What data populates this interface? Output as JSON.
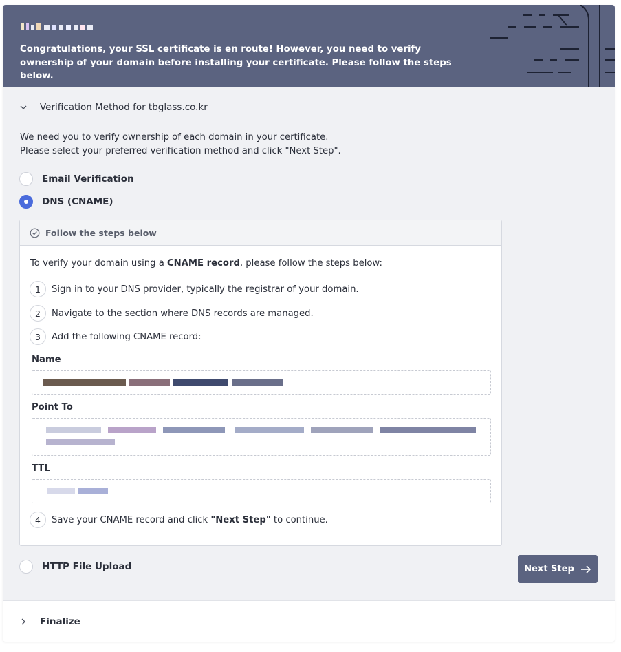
{
  "banner": {
    "title_redacted": "",
    "message": "Congratulations, your SSL certificate is en route! However, you need to verify ownership of your domain before installing your certificate. Please follow the steps below.",
    "background_color": "#5b6380"
  },
  "verification": {
    "section_title": "Verification Method for tbglass.co.kr",
    "expanded": true,
    "intro_line1": "We need you to verify ownership of each domain in your certificate.",
    "intro_line2": "Please select your preferred verification method and click \"Next Step\".",
    "methods": [
      {
        "label": "Email Verification",
        "selected": false
      },
      {
        "label": "DNS (CNAME)",
        "selected": true
      },
      {
        "label": "HTTP File Upload",
        "selected": false
      }
    ],
    "accent_color": "#4a6bdc"
  },
  "steps": {
    "header": "Follow the steps below",
    "header_icon": "check-circle-icon",
    "lead_before": "To verify your domain using a ",
    "lead_bold": "CNAME record",
    "lead_after": ", please follow the steps below:",
    "items": [
      {
        "num": "1",
        "text": "Sign in to your DNS provider, typically the registrar of your domain."
      },
      {
        "num": "2",
        "text": "Navigate to the section where DNS records are managed."
      },
      {
        "num": "3",
        "text": "Add the following CNAME record:"
      }
    ],
    "final_step": {
      "num": "4",
      "text_before": "Save your CNAME record and click ",
      "text_bold": "\"Next Step\"",
      "text_after": " to continue."
    }
  },
  "fields": {
    "name_label": "Name",
    "name_value": "",
    "point_to_label": "Point To",
    "point_to_value": "",
    "ttl_label": "TTL",
    "ttl_value": ""
  },
  "actions": {
    "next_label": "Next Step",
    "next_icon": "arrow-right-icon"
  },
  "finalize": {
    "title": "Finalize",
    "expanded": false
  }
}
